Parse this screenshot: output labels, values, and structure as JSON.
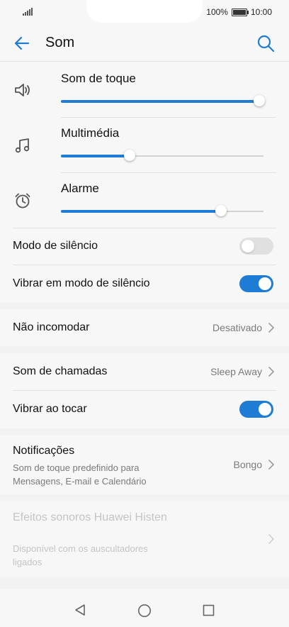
{
  "status": {
    "battery": "100%",
    "time": "10:00"
  },
  "header": {
    "title": "Som"
  },
  "volumes": [
    {
      "label": "Som de toque",
      "level": 0.98
    },
    {
      "label": "Multimédia",
      "level": 0.34
    },
    {
      "label": "Alarme",
      "level": 0.79
    }
  ],
  "silent_mode": {
    "label": "Modo de silêncio",
    "enabled": false
  },
  "vibrate_silent": {
    "label": "Vibrar em modo de silêncio",
    "enabled": true
  },
  "dnd": {
    "label": "Não incomodar",
    "value": "Desativado"
  },
  "ringtone": {
    "label": "Som de chamadas",
    "value": "Sleep Away"
  },
  "vibrate_ring": {
    "label": "Vibrar ao tocar",
    "enabled": true
  },
  "notifications": {
    "label": "Notificações",
    "subtitle": "Som de toque predefinido para Mensagens, E-mail e Calendário",
    "value": "Bongo"
  },
  "histen": {
    "label": "Efeitos sonoros Huawei Histen",
    "subtitle": "Disponível com os auscultadores ligados"
  },
  "colors": {
    "accent": "#1f7cd4",
    "background": "#f2f2f2",
    "card": "#f7f7f7"
  }
}
